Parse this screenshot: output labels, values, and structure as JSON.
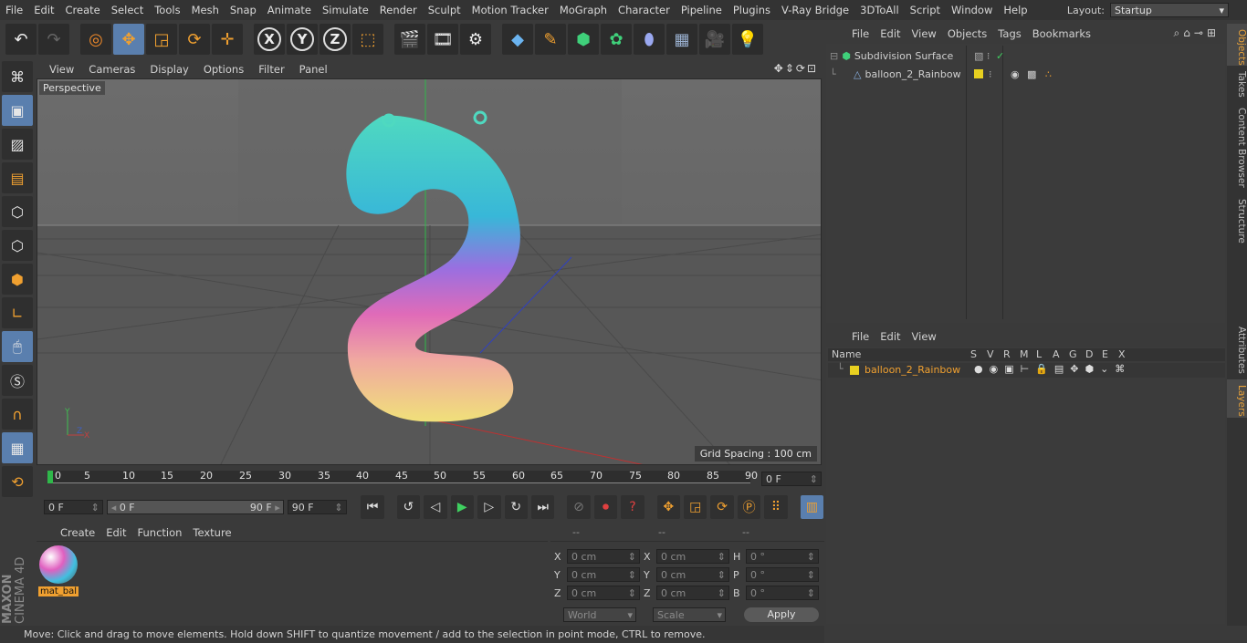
{
  "menubar": {
    "items": [
      "File",
      "Edit",
      "Create",
      "Select",
      "Tools",
      "Mesh",
      "Snap",
      "Animate",
      "Simulate",
      "Render",
      "Sculpt",
      "Motion Tracker",
      "MoGraph",
      "Character",
      "Pipeline",
      "Plugins",
      "V-Ray Bridge",
      "3DToAll",
      "Script",
      "Window",
      "Help"
    ],
    "layout_label": "Layout:",
    "layout_value": "Startup"
  },
  "toolbar": {
    "icons": [
      "undo-icon",
      "redo-icon",
      "live-selection-icon",
      "move-icon",
      "scale-icon",
      "rotate-icon",
      "transform-icon",
      "x-axis-icon",
      "y-axis-icon",
      "z-axis-icon",
      "coordinate-system-icon",
      "render-view-icon",
      "render-picture-viewer-icon",
      "edit-render-settings-icon",
      "cube-icon",
      "pen-icon",
      "subdivision-icon",
      "cloner-icon",
      "deformer-icon",
      "floor-icon",
      "camera-icon",
      "light-icon"
    ],
    "axis_labels": {
      "x": "X",
      "y": "Y",
      "z": "Z"
    }
  },
  "viewport": {
    "menu": [
      "View",
      "Cameras",
      "Display",
      "Options",
      "Filter",
      "Panel"
    ],
    "camera_label": "Perspective",
    "grid_spacing": "Grid Spacing : 100 cm"
  },
  "timeline": {
    "ticks": [
      "0",
      "5",
      "10",
      "15",
      "20",
      "25",
      "30",
      "35",
      "40",
      "45",
      "50",
      "55",
      "60",
      "65",
      "70",
      "75",
      "80",
      "85",
      "90"
    ],
    "current_frame": "0 F"
  },
  "transport": {
    "start_frame": "0 F",
    "range_start": "0 F",
    "range_end": "90 F",
    "end_frame": "90 F"
  },
  "material_manager": {
    "menu": [
      "Create",
      "Edit",
      "Function",
      "Texture"
    ],
    "materials": [
      {
        "name": "mat_bal"
      }
    ]
  },
  "coordinates": {
    "headers": [
      "--",
      "--",
      "--"
    ],
    "rows": [
      {
        "pos_label": "X",
        "pos": "0 cm",
        "size_label": "X",
        "size": "0 cm",
        "rot_label": "H",
        "rot": "0 °"
      },
      {
        "pos_label": "Y",
        "pos": "0 cm",
        "size_label": "Y",
        "size": "0 cm",
        "rot_label": "P",
        "rot": "0 °"
      },
      {
        "pos_label": "Z",
        "pos": "0 cm",
        "size_label": "Z",
        "size": "0 cm",
        "rot_label": "B",
        "rot": "0 °"
      }
    ],
    "mode": "World",
    "scale_mode": "Scale",
    "apply": "Apply"
  },
  "objects_panel": {
    "menu": [
      "File",
      "Edit",
      "View",
      "Objects",
      "Tags",
      "Bookmarks"
    ],
    "items": [
      {
        "name": "Subdivision Surface",
        "level": 0,
        "color": "#c8c8c8"
      },
      {
        "name": "balloon_2_Rainbow",
        "level": 1,
        "color": "#c8c8c8"
      }
    ]
  },
  "layers_panel": {
    "menu": [
      "File",
      "Edit",
      "View"
    ],
    "columns": [
      "Name",
      "S",
      "V",
      "R",
      "M",
      "L",
      "A",
      "G",
      "D",
      "E",
      "X"
    ],
    "rows": [
      {
        "name": "balloon_2_Rainbow",
        "color": "#e8d020"
      }
    ]
  },
  "side_tabs": [
    "Objects",
    "Takes",
    "Content Browser",
    "Structure",
    "Attributes",
    "Layers"
  ],
  "status": "Move: Click and drag to move elements. Hold down SHIFT to quantize movement / add to the selection in point mode, CTRL to remove.",
  "branding": {
    "line1": "MAXON",
    "line2": "CINEMA 4D"
  },
  "colors": {
    "accent": "#5a7fae",
    "highlight": "#e8a23a",
    "selected_layer": "#e8d020"
  }
}
